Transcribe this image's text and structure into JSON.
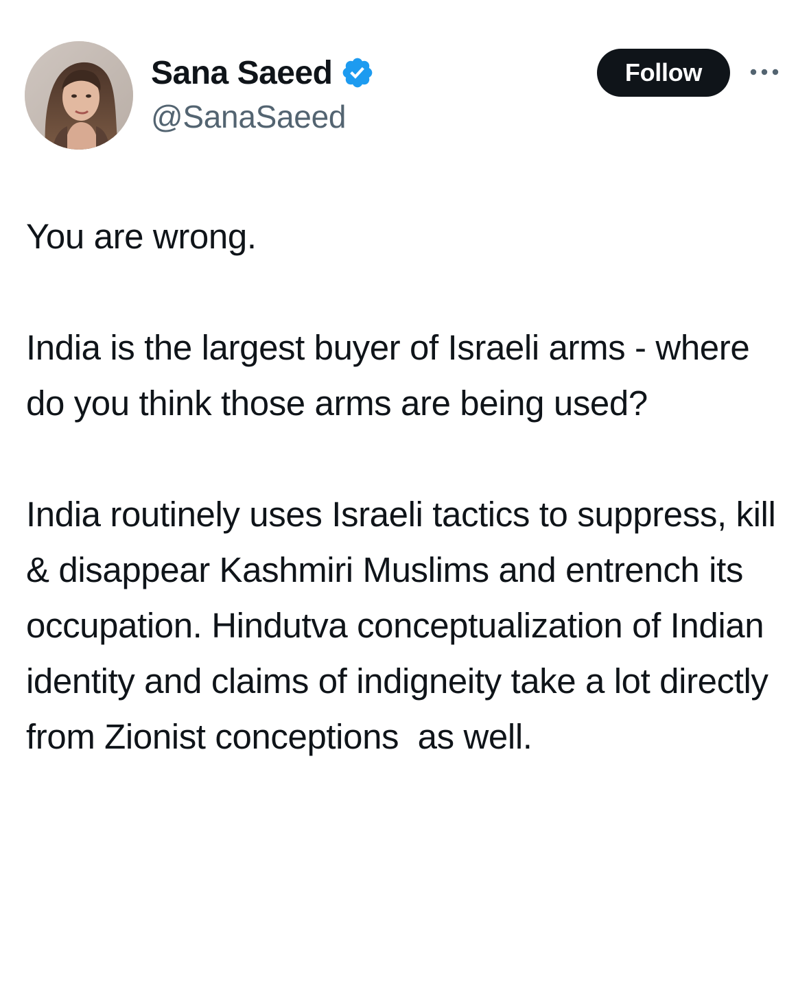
{
  "author": {
    "display_name": "Sana Saeed",
    "handle": "@SanaSaeed",
    "verified": true,
    "avatar_icon": "profile-photo",
    "verified_icon": "verified-badge-icon"
  },
  "actions": {
    "follow_label": "Follow",
    "more_icon": "more-options-icon"
  },
  "tweet": {
    "paragraphs": [
      "You are wrong.",
      "India is the largest buyer of Israeli arms - where do you think those arms are being used?",
      "India routinely uses Israeli tactics to suppress, kill & disappear Kashmiri Muslims and entrench its occupation. Hindutva conceptualization of Indian identity and claims of indigneity take a lot directly from Zionist conceptions  as well."
    ]
  },
  "colors": {
    "text_primary": "#0f1419",
    "text_secondary": "#536471",
    "verified_blue": "#1d9bf0",
    "follow_bg": "#0f1419",
    "follow_text": "#ffffff"
  }
}
